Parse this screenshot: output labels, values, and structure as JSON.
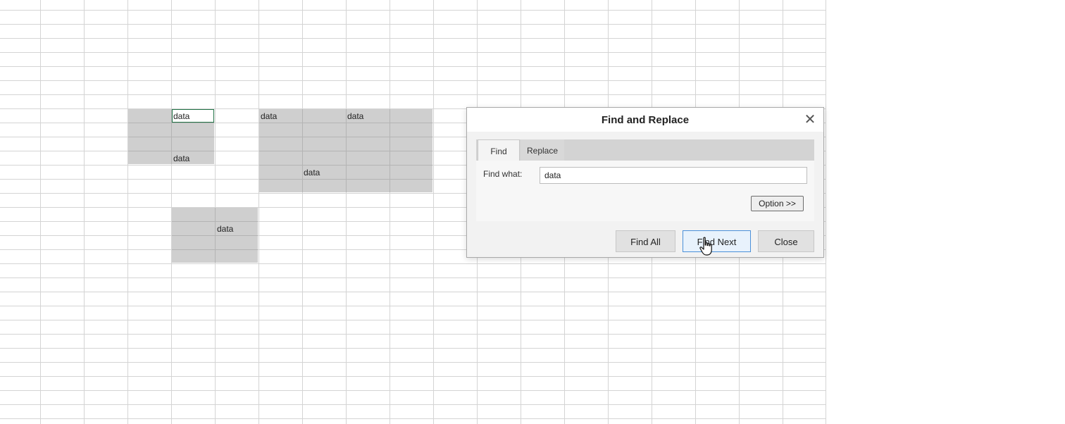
{
  "sheet": {
    "cells": [
      {
        "ref": "D8",
        "value": "data"
      },
      {
        "ref": "G8",
        "value": "data"
      },
      {
        "ref": "I8",
        "value": "data"
      },
      {
        "ref": "D11",
        "value": "data"
      },
      {
        "ref": "H12",
        "value": "data"
      },
      {
        "ref": "F16",
        "value": "data"
      }
    ]
  },
  "dialog": {
    "title": "Find and Replace",
    "close_icon": "close-icon",
    "tabs": [
      {
        "label": "Find",
        "active": true
      },
      {
        "label": "Replace",
        "active": false
      }
    ],
    "find_label": "Find what:",
    "find_value": "data",
    "option_button": "Option >>",
    "buttons": {
      "find_all": "Find All",
      "find_next": "Find Next",
      "close": "Close"
    }
  },
  "colors": {
    "selection": "#a6a6a6",
    "active_cell_border": "#217346",
    "focus_button_border": "#4a90d9"
  },
  "cursor_icon": "hand-pointer-icon"
}
